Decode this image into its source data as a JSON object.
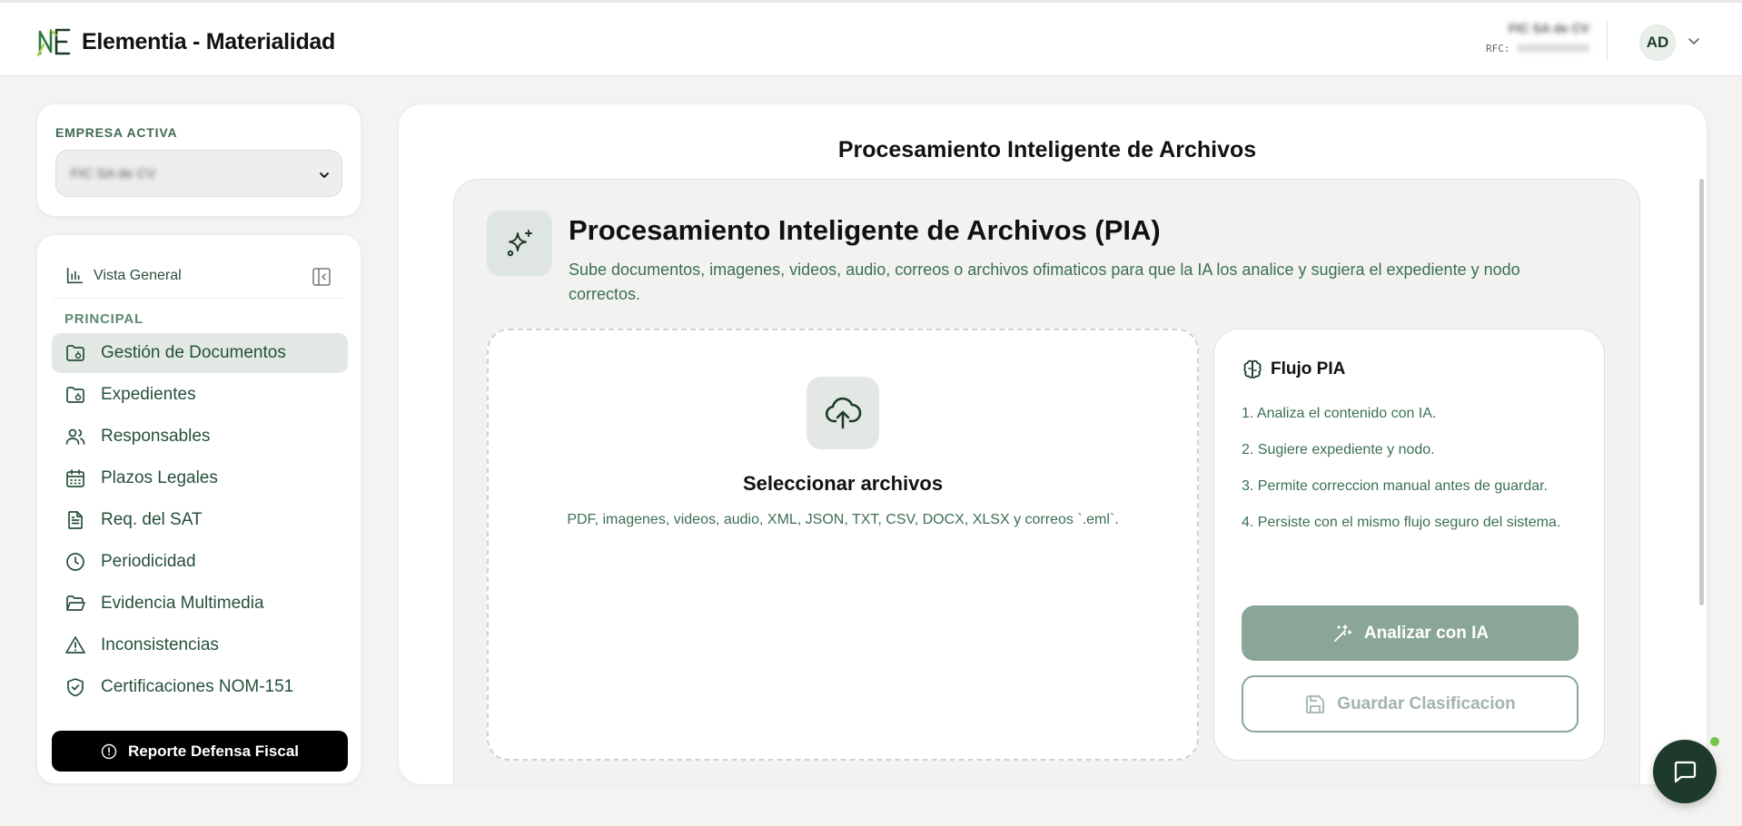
{
  "app": {
    "name": "Elementia - Materialidad",
    "accent": "#1e3a2b",
    "accent_text": "#3c7052"
  },
  "header": {
    "company_name": "FIC SA de CV",
    "rfc_label": "RFC:",
    "rfc_value": "XXXXXXXXXXXX",
    "avatar_initials": "AD"
  },
  "sidebar": {
    "company_label": "EMPRESA ACTIVA",
    "company_selected": "FIC SA de CV",
    "overview_label": "Vista General",
    "section_label": "PRINCIPAL",
    "items": [
      {
        "label": "Gestión de Documentos",
        "icon": "folder-doc-icon",
        "active": true
      },
      {
        "label": "Expedientes",
        "icon": "folder-clock-icon",
        "active": false
      },
      {
        "label": "Responsables",
        "icon": "users-icon",
        "active": false
      },
      {
        "label": "Plazos Legales",
        "icon": "calendar-icon",
        "active": false
      },
      {
        "label": "Req. del SAT",
        "icon": "document-icon",
        "active": false
      },
      {
        "label": "Periodicidad",
        "icon": "clock-icon",
        "active": false
      },
      {
        "label": "Evidencia Multimedia",
        "icon": "folder-open-icon",
        "active": false
      },
      {
        "label": "Inconsistencias",
        "icon": "warning-icon",
        "active": false
      },
      {
        "label": "Certificaciones NOM-151",
        "icon": "shield-check-icon",
        "active": false
      }
    ],
    "report_button": "Reporte Defensa Fiscal"
  },
  "main": {
    "title": "Procesamiento Inteligente de Archivos",
    "pia": {
      "title": "Procesamiento Inteligente de Archivos (PIA)",
      "description": "Sube documentos, imagenes, videos, audio, correos o archivos ofimaticos para que la IA los analice y sugiera el expediente y nodo correctos."
    },
    "dropzone": {
      "title": "Seleccionar archivos",
      "subtitle": "PDF, imagenes, videos, audio, XML, JSON, TXT, CSV, DOCX, XLSX y correos `.eml`."
    },
    "flow": {
      "title": "Flujo PIA",
      "steps": [
        "1. Analiza el contenido con IA.",
        "2. Sugiere expediente y nodo.",
        "3. Permite correccion manual antes de guardar.",
        "4. Persiste con el mismo flujo seguro del sistema."
      ],
      "analyze_button": "Analizar con IA",
      "save_button": "Guardar Clasificacion"
    }
  }
}
